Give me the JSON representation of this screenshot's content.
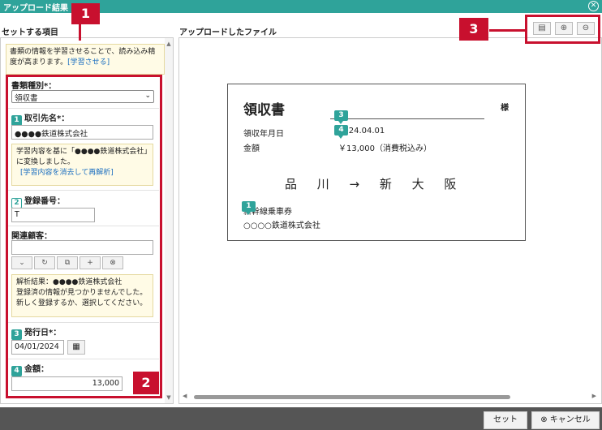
{
  "window": {
    "title": "アップロード結果",
    "close_icon": "close-circle-icon"
  },
  "left": {
    "header": "セットする項目",
    "learn_text": "書類の情報を学習させることで、読み込み精度が高まります。",
    "learn_link": "[学習させる]",
    "doc_type_label": "書類種別*：",
    "doc_type_value": "領収書",
    "partner_label": "取引先名*：",
    "partner_value": "●●●●鉄道株式会社",
    "partner_note": "学習内容を基に「●●●●鉄道株式会社」に変換しました。",
    "partner_note_link": "[学習内容を消去して再解析]",
    "reg_label": "登録番号：",
    "reg_value": "T",
    "customer_label": "関連顧客：",
    "customer_value": "",
    "customer_note": "解析結果：●●●●鉄道株式会社\n登録済の情報が見つかりませんでした。\n新しく登録するか、選択してください。",
    "issue_label": "発行日*：",
    "issue_value": "04/01/2024",
    "amount_label": "金額：",
    "amount_value": "13,000",
    "numbers": {
      "n1": "1",
      "n2": "2",
      "n3": "3",
      "n4": "4"
    }
  },
  "right": {
    "header": "アップロードしたファイル",
    "receipt": {
      "title": "領収書",
      "sama": "様",
      "date_label": "領収年月日",
      "date_value": "2024.04.01",
      "amount_label": "金額",
      "amount_value": "￥13,000（消費税込み）",
      "route": "品 川 → 新 大 阪",
      "ticket": "新幹線乗車券",
      "issuer": "○○○○鉄道株式会社"
    }
  },
  "callouts": {
    "c1": "1",
    "c2": "2",
    "c3": "3"
  },
  "footer": {
    "set_label": "セット",
    "cancel_label": "キャンセル"
  },
  "colors": {
    "accent": "#2fa39a",
    "callout": "#c8102e"
  }
}
